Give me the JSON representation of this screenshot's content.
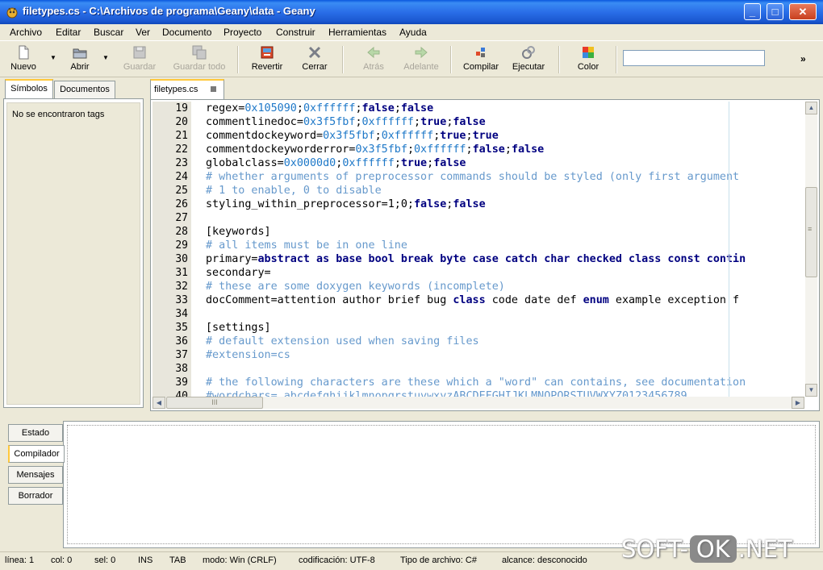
{
  "window": {
    "title": "filetypes.cs - C:\\Archivos de programa\\Geany\\data - Geany",
    "controls": {
      "minimize": "_",
      "maximize": "□",
      "close": "✕"
    }
  },
  "menu": [
    "Archivo",
    "Editar",
    "Buscar",
    "Ver",
    "Documento",
    "Proyecto",
    "Construir",
    "Herramientas",
    "Ayuda"
  ],
  "toolbar": {
    "nuevo": "Nuevo",
    "abrir": "Abrir",
    "guardar": "Guardar",
    "guardar_todo": "Guardar todo",
    "revertir": "Revertir",
    "cerrar": "Cerrar",
    "atras": "Atrás",
    "adelante": "Adelante",
    "compilar": "Compilar",
    "ejecutar": "Ejecutar",
    "color": "Color",
    "search_value": "",
    "more": "»"
  },
  "sidebar": {
    "tabs": [
      "Símbolos",
      "Documentos"
    ],
    "message": "No se encontraron tags"
  },
  "editor": {
    "tab_label": "filetypes.cs",
    "lines": [
      {
        "n": "19",
        "segs": [
          [
            "t",
            "regex="
          ],
          [
            "h",
            "0x105090"
          ],
          [
            "t",
            ";"
          ],
          [
            "h",
            "0xffffff"
          ],
          [
            "t",
            ";"
          ],
          [
            "k",
            "false"
          ],
          [
            "t",
            ";"
          ],
          [
            "k",
            "false"
          ]
        ]
      },
      {
        "n": "20",
        "segs": [
          [
            "t",
            "commentlinedoc="
          ],
          [
            "h",
            "0x3f5fbf"
          ],
          [
            "t",
            ";"
          ],
          [
            "h",
            "0xffffff"
          ],
          [
            "t",
            ";"
          ],
          [
            "k",
            "true"
          ],
          [
            "t",
            ";"
          ],
          [
            "k",
            "false"
          ]
        ]
      },
      {
        "n": "21",
        "segs": [
          [
            "t",
            "commentdockeyword="
          ],
          [
            "h",
            "0x3f5fbf"
          ],
          [
            "t",
            ";"
          ],
          [
            "h",
            "0xffffff"
          ],
          [
            "t",
            ";"
          ],
          [
            "k",
            "true"
          ],
          [
            "t",
            ";"
          ],
          [
            "k",
            "true"
          ]
        ]
      },
      {
        "n": "22",
        "segs": [
          [
            "t",
            "commentdockeyworderror="
          ],
          [
            "h",
            "0x3f5fbf"
          ],
          [
            "t",
            ";"
          ],
          [
            "h",
            "0xffffff"
          ],
          [
            "t",
            ";"
          ],
          [
            "k",
            "false"
          ],
          [
            "t",
            ";"
          ],
          [
            "k",
            "false"
          ]
        ]
      },
      {
        "n": "23",
        "segs": [
          [
            "t",
            "globalclass="
          ],
          [
            "h",
            "0x0000d0"
          ],
          [
            "t",
            ";"
          ],
          [
            "h",
            "0xffffff"
          ],
          [
            "t",
            ";"
          ],
          [
            "k",
            "true"
          ],
          [
            "t",
            ";"
          ],
          [
            "k",
            "false"
          ]
        ]
      },
      {
        "n": "24",
        "segs": [
          [
            "c",
            "# whether arguments of preprocessor commands should be styled (only first argument"
          ]
        ]
      },
      {
        "n": "25",
        "segs": [
          [
            "c",
            "# 1 to enable, 0 to disable"
          ]
        ]
      },
      {
        "n": "26",
        "segs": [
          [
            "t",
            "styling_within_preprocessor=1;0;"
          ],
          [
            "k",
            "false"
          ],
          [
            "t",
            ";"
          ],
          [
            "k",
            "false"
          ]
        ]
      },
      {
        "n": "27",
        "segs": []
      },
      {
        "n": "28",
        "segs": [
          [
            "t",
            "[keywords]"
          ]
        ]
      },
      {
        "n": "29",
        "segs": [
          [
            "c",
            "# all items must be in one line"
          ]
        ]
      },
      {
        "n": "30",
        "segs": [
          [
            "t",
            "primary="
          ],
          [
            "k",
            "abstract as base bool break byte case catch char checked class const contin"
          ]
        ]
      },
      {
        "n": "31",
        "segs": [
          [
            "t",
            "secondary="
          ]
        ]
      },
      {
        "n": "32",
        "segs": [
          [
            "c",
            "# these are some doxygen keywords (incomplete)"
          ]
        ]
      },
      {
        "n": "33",
        "segs": [
          [
            "t",
            "docComment=attention author brief bug "
          ],
          [
            "k",
            "class"
          ],
          [
            "t",
            " code date def "
          ],
          [
            "k",
            "enum"
          ],
          [
            "t",
            " example exception f"
          ]
        ]
      },
      {
        "n": "34",
        "segs": []
      },
      {
        "n": "35",
        "segs": [
          [
            "t",
            "[settings]"
          ]
        ]
      },
      {
        "n": "36",
        "segs": [
          [
            "c",
            "# default extension used when saving files"
          ]
        ]
      },
      {
        "n": "37",
        "segs": [
          [
            "c",
            "#extension=cs"
          ]
        ]
      },
      {
        "n": "38",
        "segs": []
      },
      {
        "n": "39",
        "segs": [
          [
            "c",
            "# the following characters are these which a \"word\" can contains, see documentation"
          ]
        ]
      },
      {
        "n": "40",
        "segs": [
          [
            "c",
            "#wordchars= abcdefghijklmnopqrstuvwxyzABCDEFGHIJKLMNOPQRSTUVWXYZ0123456789"
          ]
        ]
      }
    ],
    "hscroll_grip": "III",
    "vscroll_grip": "≡"
  },
  "bottom": {
    "tabs": [
      "Estado",
      "Compilador",
      "Mensajes",
      "Borrador"
    ],
    "active_tab": "Compilador"
  },
  "status": {
    "linea": "línea: 1",
    "col": "col: 0",
    "sel": "sel: 0",
    "ins": "INS",
    "tab": "TAB",
    "modo": "modo: Win (CRLF)",
    "codificacion": "codificación: UTF-8",
    "tipo": "Tipo de archivo: C#",
    "alcance": "alcance: desconocido"
  },
  "watermark": {
    "left": "SOFT-",
    "ok": "OK",
    "right": ".NET"
  }
}
